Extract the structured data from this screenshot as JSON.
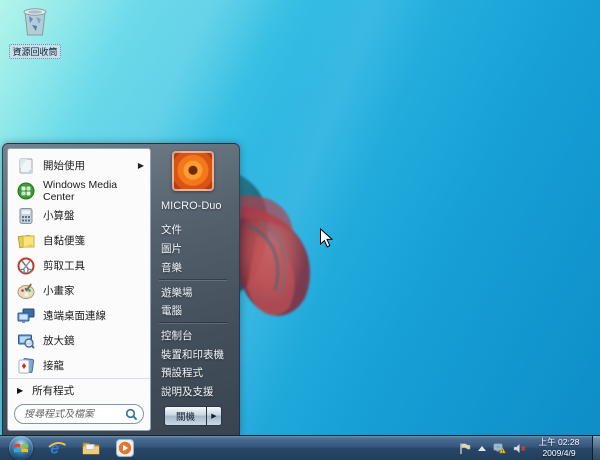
{
  "desktop": {
    "recycle_bin_label": "資源回收筒"
  },
  "start_menu": {
    "left_items": [
      {
        "label": "開始使用",
        "icon": "getting-started-icon",
        "has_submenu": true
      },
      {
        "label": "Windows Media Center",
        "icon": "media-center-icon"
      },
      {
        "label": "小算盤",
        "icon": "calculator-icon"
      },
      {
        "label": "自黏便箋",
        "icon": "sticky-notes-icon"
      },
      {
        "label": "剪取工具",
        "icon": "snipping-tool-icon"
      },
      {
        "label": "小畫家",
        "icon": "paint-icon"
      },
      {
        "label": "遠端桌面連線",
        "icon": "remote-desktop-icon"
      },
      {
        "label": "放大鏡",
        "icon": "magnifier-icon"
      },
      {
        "label": "接龍",
        "icon": "solitaire-icon"
      }
    ],
    "submenu_arrow": "▶",
    "all_programs_label": "所有程式",
    "all_programs_arrow": "▶",
    "search_placeholder": "搜尋程式及檔案",
    "user_name": "MICRO-Duo",
    "right_items": [
      "文件",
      "圖片",
      "音樂",
      "遊樂場",
      "電腦",
      "控制台",
      "裝置和印表機",
      "預設程式",
      "說明及支援"
    ],
    "shutdown_label": "關機",
    "shutdown_arrow": "▶"
  },
  "taskbar": {
    "app_icons": [
      "start-orb",
      "internet-explorer-icon",
      "explorer-folder-icon",
      "media-player-icon"
    ],
    "tray_icons": [
      "action-center-flag-icon",
      "show-hidden-icons-arrow",
      "network-warning-icon",
      "volume-muted-icon"
    ],
    "clock_time": "上午 02:28",
    "clock_date": "2009/4/9"
  },
  "colors": {
    "desktop_top_left": "#96F1E2",
    "desktop_bottom_right": "#0E8CC6",
    "taskbar_glass": "#35567C",
    "start_menu_glass": "#4A5662",
    "left_panel_bg": "#FBFBFB",
    "fish_red": "#C23B3B",
    "fish_teal": "#1D6B7D"
  }
}
